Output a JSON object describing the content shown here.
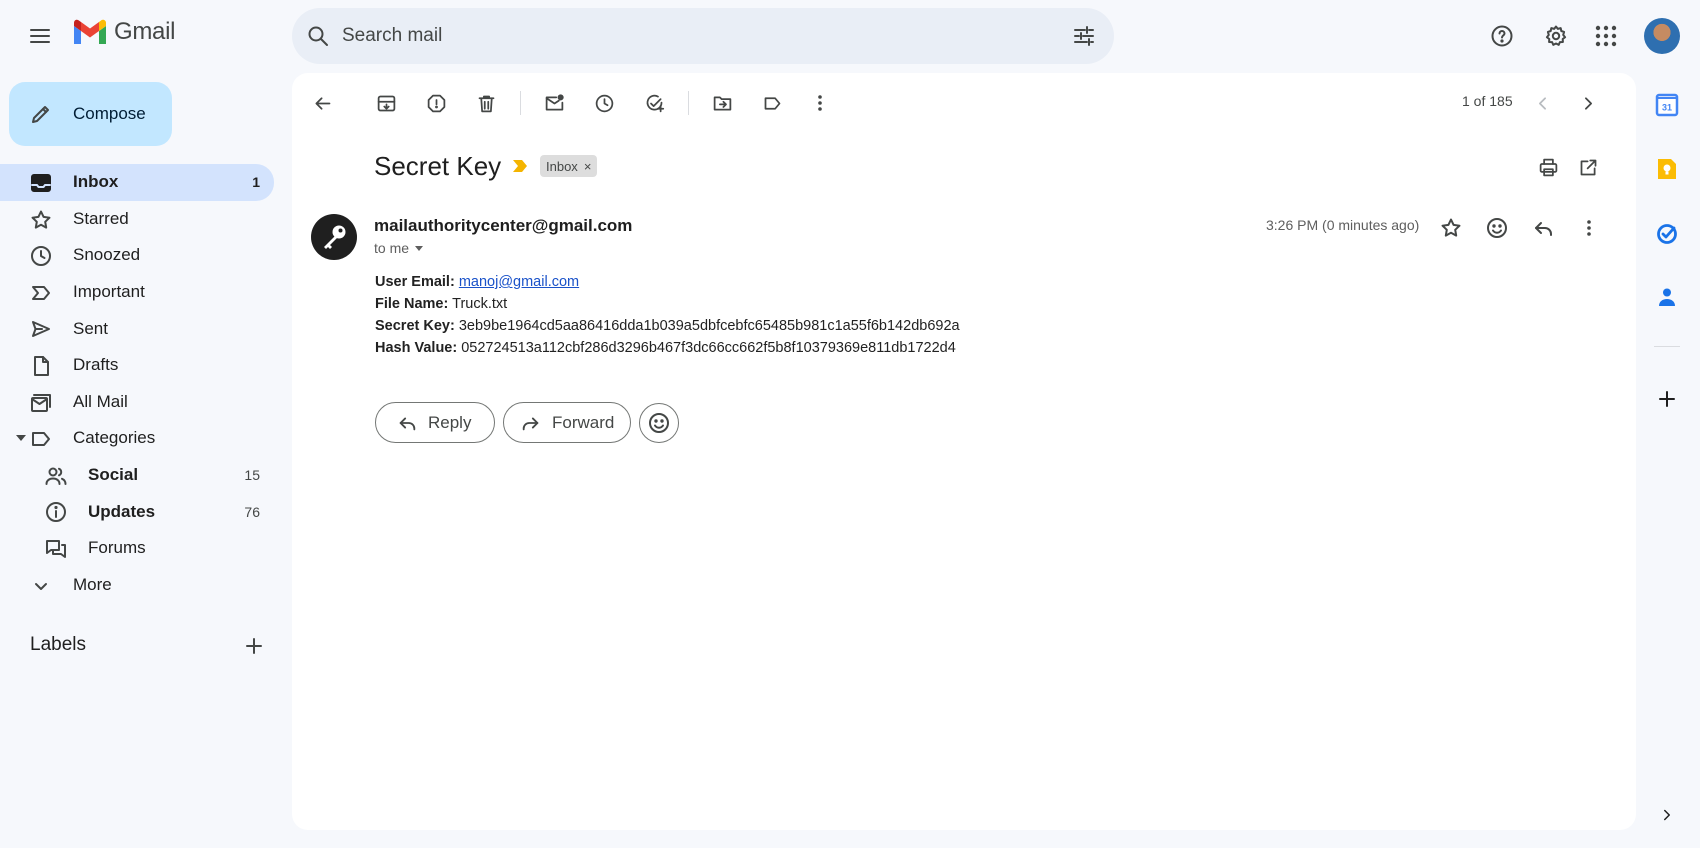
{
  "app": {
    "name": "Gmail"
  },
  "search": {
    "placeholder": "Search mail"
  },
  "compose": {
    "label": "Compose"
  },
  "sidebar": {
    "items": [
      {
        "label": "Inbox",
        "count": "1"
      },
      {
        "label": "Starred"
      },
      {
        "label": "Snoozed"
      },
      {
        "label": "Important"
      },
      {
        "label": "Sent"
      },
      {
        "label": "Drafts"
      },
      {
        "label": "All Mail"
      },
      {
        "label": "Categories"
      }
    ],
    "categories": [
      {
        "label": "Social",
        "count": "15"
      },
      {
        "label": "Updates",
        "count": "76"
      },
      {
        "label": "Forums"
      }
    ],
    "more": "More",
    "labels_heading": "Labels"
  },
  "toolbar": {
    "pager": "1 of 185"
  },
  "email": {
    "subject": "Secret Key",
    "label_chip": "Inbox",
    "label_chip_close": "×",
    "sender": "mailauthoritycenter@gmail.com",
    "recipient": "to me",
    "time": "3:26 PM (0 minutes ago)",
    "body": {
      "user_email_label": "User Email:",
      "user_email_value": "manoj@gmail.com",
      "file_name_label": "File Name:",
      "file_name_value": "Truck.txt",
      "secret_key_label": "Secret Key:",
      "secret_key_value": "3eb9be1964cd5aa86416dda1b039a5dbfcebfc65485b981c1a55f6b142db692a",
      "hash_value_label": "Hash Value:",
      "hash_value_value": "052724513a112cbf286d3296b467f3dc66cc662f5b8f10379369e811db1722d4"
    },
    "actions": {
      "reply": "Reply",
      "forward": "Forward"
    }
  },
  "right_rail": {
    "calendar_day": "31"
  },
  "colors": {
    "background": "#f6f8fc",
    "compose": "#c2e7ff",
    "active_nav": "#d3e3fd",
    "link": "#1a52c9",
    "important_marker": "#f4b400"
  }
}
